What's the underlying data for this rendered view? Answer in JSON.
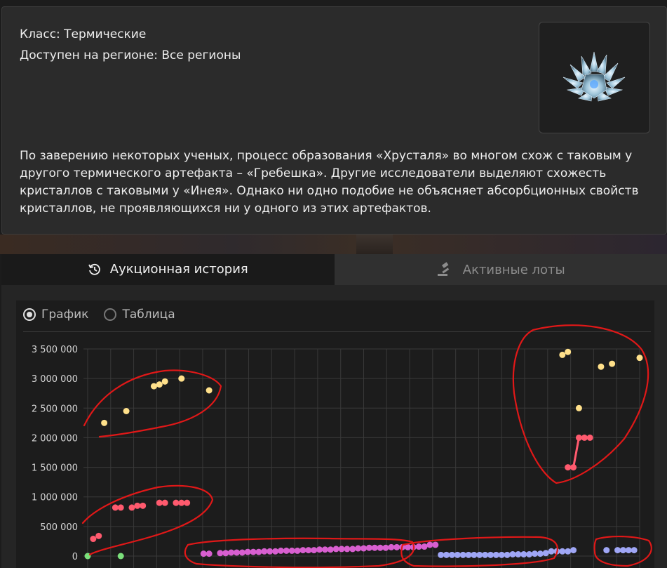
{
  "info": {
    "class_line": "Класс: Термические",
    "region_line": "Доступен на регионе: Все регионы",
    "description": "По заверению некоторых ученых, процесс образования «Хрусталя» во многом схож с таковым у другого термического артефакта – «Гребешка». Другие исследователи выделяют схожесть кристаллов с таковыми у «Инея». Однако ни одно подобие не объясняет абсорбционных свойств кристаллов, не проявляющихся ни у одного из этих артефактов."
  },
  "tabs": {
    "history_label": "Аукционная история",
    "history_icon": "history-icon",
    "lots_label": "Активные лоты",
    "lots_icon": "gavel-icon"
  },
  "view_toggle": {
    "graph_label": "График",
    "table_label": "Таблица",
    "selected": "График"
  },
  "colors": {
    "yellow": "#ffe08a",
    "red": "#ff5a6e",
    "magenta": "#d85fd0",
    "lavender": "#9fa6f5",
    "green": "#7be07b",
    "annotation": "#e01818",
    "accent_tab": "#1a1a1a"
  },
  "chart_data": {
    "type": "scatter",
    "ylim": [
      0,
      3500000
    ],
    "y_ticks": [
      "3 500 000",
      "3 000 000",
      "2 500 000",
      "2 000 000",
      "1 500 000",
      "1 000 000",
      "500 000",
      "0"
    ],
    "y_tick_values": [
      3500000,
      3000000,
      2500000,
      2000000,
      1500000,
      1000000,
      500000,
      0
    ],
    "x_index_range": [
      0,
      100
    ],
    "grid": true,
    "series": [
      {
        "color": "yellow",
        "points": [
          [
            3,
            2250000
          ],
          [
            7,
            2450000
          ],
          [
            12,
            2870000
          ],
          [
            13,
            2900000
          ],
          [
            14,
            2950000
          ],
          [
            17,
            3000000
          ],
          [
            22,
            2800000
          ],
          [
            86,
            3400000
          ],
          [
            87,
            3450000
          ],
          [
            89,
            2500000
          ],
          [
            93,
            3200000
          ],
          [
            95,
            3250000
          ],
          [
            100,
            3350000
          ]
        ]
      },
      {
        "color": "red",
        "points": [
          [
            1,
            290000
          ],
          [
            2,
            340000
          ],
          [
            5,
            820000
          ],
          [
            6,
            820000
          ],
          [
            8,
            820000
          ],
          [
            9,
            850000
          ],
          [
            10,
            850000
          ],
          [
            13,
            900000
          ],
          [
            14,
            900000
          ],
          [
            16,
            900000
          ],
          [
            17,
            900000
          ],
          [
            18,
            900000
          ],
          [
            87,
            1500000
          ],
          [
            88,
            1500000
          ],
          [
            89,
            2000000
          ],
          [
            90,
            2000000
          ],
          [
            91,
            2000000
          ]
        ],
        "connected_points": [
          [
            88,
            1500000
          ],
          [
            89,
            2000000
          ]
        ]
      },
      {
        "color": "magenta",
        "points": [
          [
            21,
            40000
          ],
          [
            22,
            40000
          ],
          [
            24,
            50000
          ],
          [
            25,
            50000
          ],
          [
            26,
            60000
          ],
          [
            27,
            60000
          ],
          [
            28,
            60000
          ],
          [
            29,
            70000
          ],
          [
            30,
            70000
          ],
          [
            31,
            70000
          ],
          [
            32,
            80000
          ],
          [
            33,
            80000
          ],
          [
            34,
            80000
          ],
          [
            35,
            90000
          ],
          [
            36,
            90000
          ],
          [
            37,
            90000
          ],
          [
            38,
            90000
          ],
          [
            39,
            100000
          ],
          [
            40,
            100000
          ],
          [
            41,
            100000
          ],
          [
            42,
            110000
          ],
          [
            43,
            110000
          ],
          [
            44,
            110000
          ],
          [
            45,
            120000
          ],
          [
            46,
            120000
          ],
          [
            47,
            120000
          ],
          [
            48,
            120000
          ],
          [
            49,
            130000
          ],
          [
            50,
            130000
          ],
          [
            51,
            140000
          ],
          [
            52,
            140000
          ],
          [
            53,
            140000
          ],
          [
            54,
            140000
          ],
          [
            55,
            150000
          ],
          [
            56,
            150000
          ],
          [
            57,
            150000
          ],
          [
            58,
            150000
          ],
          [
            59,
            150000
          ],
          [
            60,
            160000
          ],
          [
            61,
            160000
          ],
          [
            62,
            190000
          ],
          [
            63,
            190000
          ]
        ]
      },
      {
        "color": "lavender",
        "points": [
          [
            64,
            20000
          ],
          [
            65,
            20000
          ],
          [
            66,
            20000
          ],
          [
            67,
            20000
          ],
          [
            68,
            20000
          ],
          [
            69,
            20000
          ],
          [
            70,
            20000
          ],
          [
            71,
            20000
          ],
          [
            72,
            20000
          ],
          [
            73,
            20000
          ],
          [
            74,
            20000
          ],
          [
            75,
            20000
          ],
          [
            76,
            20000
          ],
          [
            77,
            30000
          ],
          [
            78,
            30000
          ],
          [
            79,
            30000
          ],
          [
            80,
            30000
          ],
          [
            81,
            40000
          ],
          [
            82,
            40000
          ],
          [
            83,
            50000
          ],
          [
            84,
            80000
          ],
          [
            85,
            80000
          ],
          [
            86,
            80000
          ],
          [
            87,
            80000
          ],
          [
            88,
            100000
          ],
          [
            94,
            100000
          ],
          [
            96,
            100000
          ],
          [
            97,
            100000
          ],
          [
            98,
            100000
          ],
          [
            99,
            100000
          ]
        ]
      },
      {
        "color": "green",
        "points": [
          [
            0,
            0
          ],
          [
            6,
            0
          ]
        ]
      }
    ]
  }
}
